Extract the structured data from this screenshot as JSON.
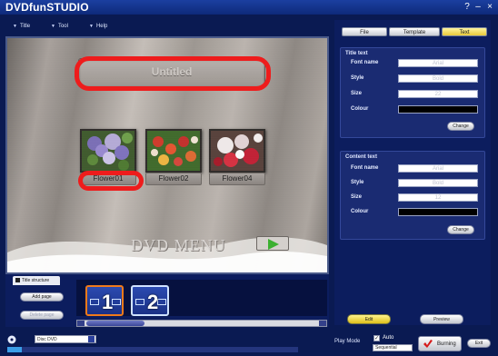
{
  "window": {
    "title": "DVDfunSTUDIO",
    "help_glyph": "?",
    "minimize_glyph": "–",
    "close_glyph": "×"
  },
  "menu": {
    "items": [
      "Title",
      "Tool",
      "Help"
    ]
  },
  "tabs": [
    {
      "label": "File",
      "active": false
    },
    {
      "label": "Template",
      "active": false
    },
    {
      "label": "Text",
      "active": true
    }
  ],
  "preview": {
    "title_text": "Untitled",
    "thumbnails": [
      {
        "label": "Flower01",
        "highlighted": true
      },
      {
        "label": "Flower02",
        "highlighted": false
      },
      {
        "label": "Flower04",
        "highlighted": false
      }
    ],
    "menu_caption": "DVD MENU",
    "highlight_color": "#ee1c1c"
  },
  "title_text_panel": {
    "heading": "Title text",
    "rows": [
      {
        "label": "Font name",
        "value": "Arial"
      },
      {
        "label": "Style",
        "value": "Bold"
      },
      {
        "label": "Size",
        "value": "22"
      },
      {
        "label": "Colour",
        "value": ""
      }
    ],
    "change_label": "Change"
  },
  "content_text_panel": {
    "heading": "Content text",
    "rows": [
      {
        "label": "Font name",
        "value": "Arial"
      },
      {
        "label": "Style",
        "value": "Bold"
      },
      {
        "label": "Size",
        "value": "12"
      },
      {
        "label": "Colour",
        "value": ""
      }
    ],
    "change_label": "Change"
  },
  "mode_buttons": {
    "edit": "Edit",
    "preview": "Preview"
  },
  "structure": {
    "tab_label": "Title structure",
    "add_page": "Add page",
    "second_button": "Delete page",
    "titles": [
      "1",
      "2"
    ]
  },
  "bottom": {
    "disc_type": "Disc DVD",
    "play_mode_label": "Play Mode",
    "auto_label": "Auto",
    "auto_checked": "✓",
    "sequence_value": "Sequential",
    "burn_label": "Burning",
    "exit_label": "Exit",
    "capacity_fraction": 0.05
  }
}
